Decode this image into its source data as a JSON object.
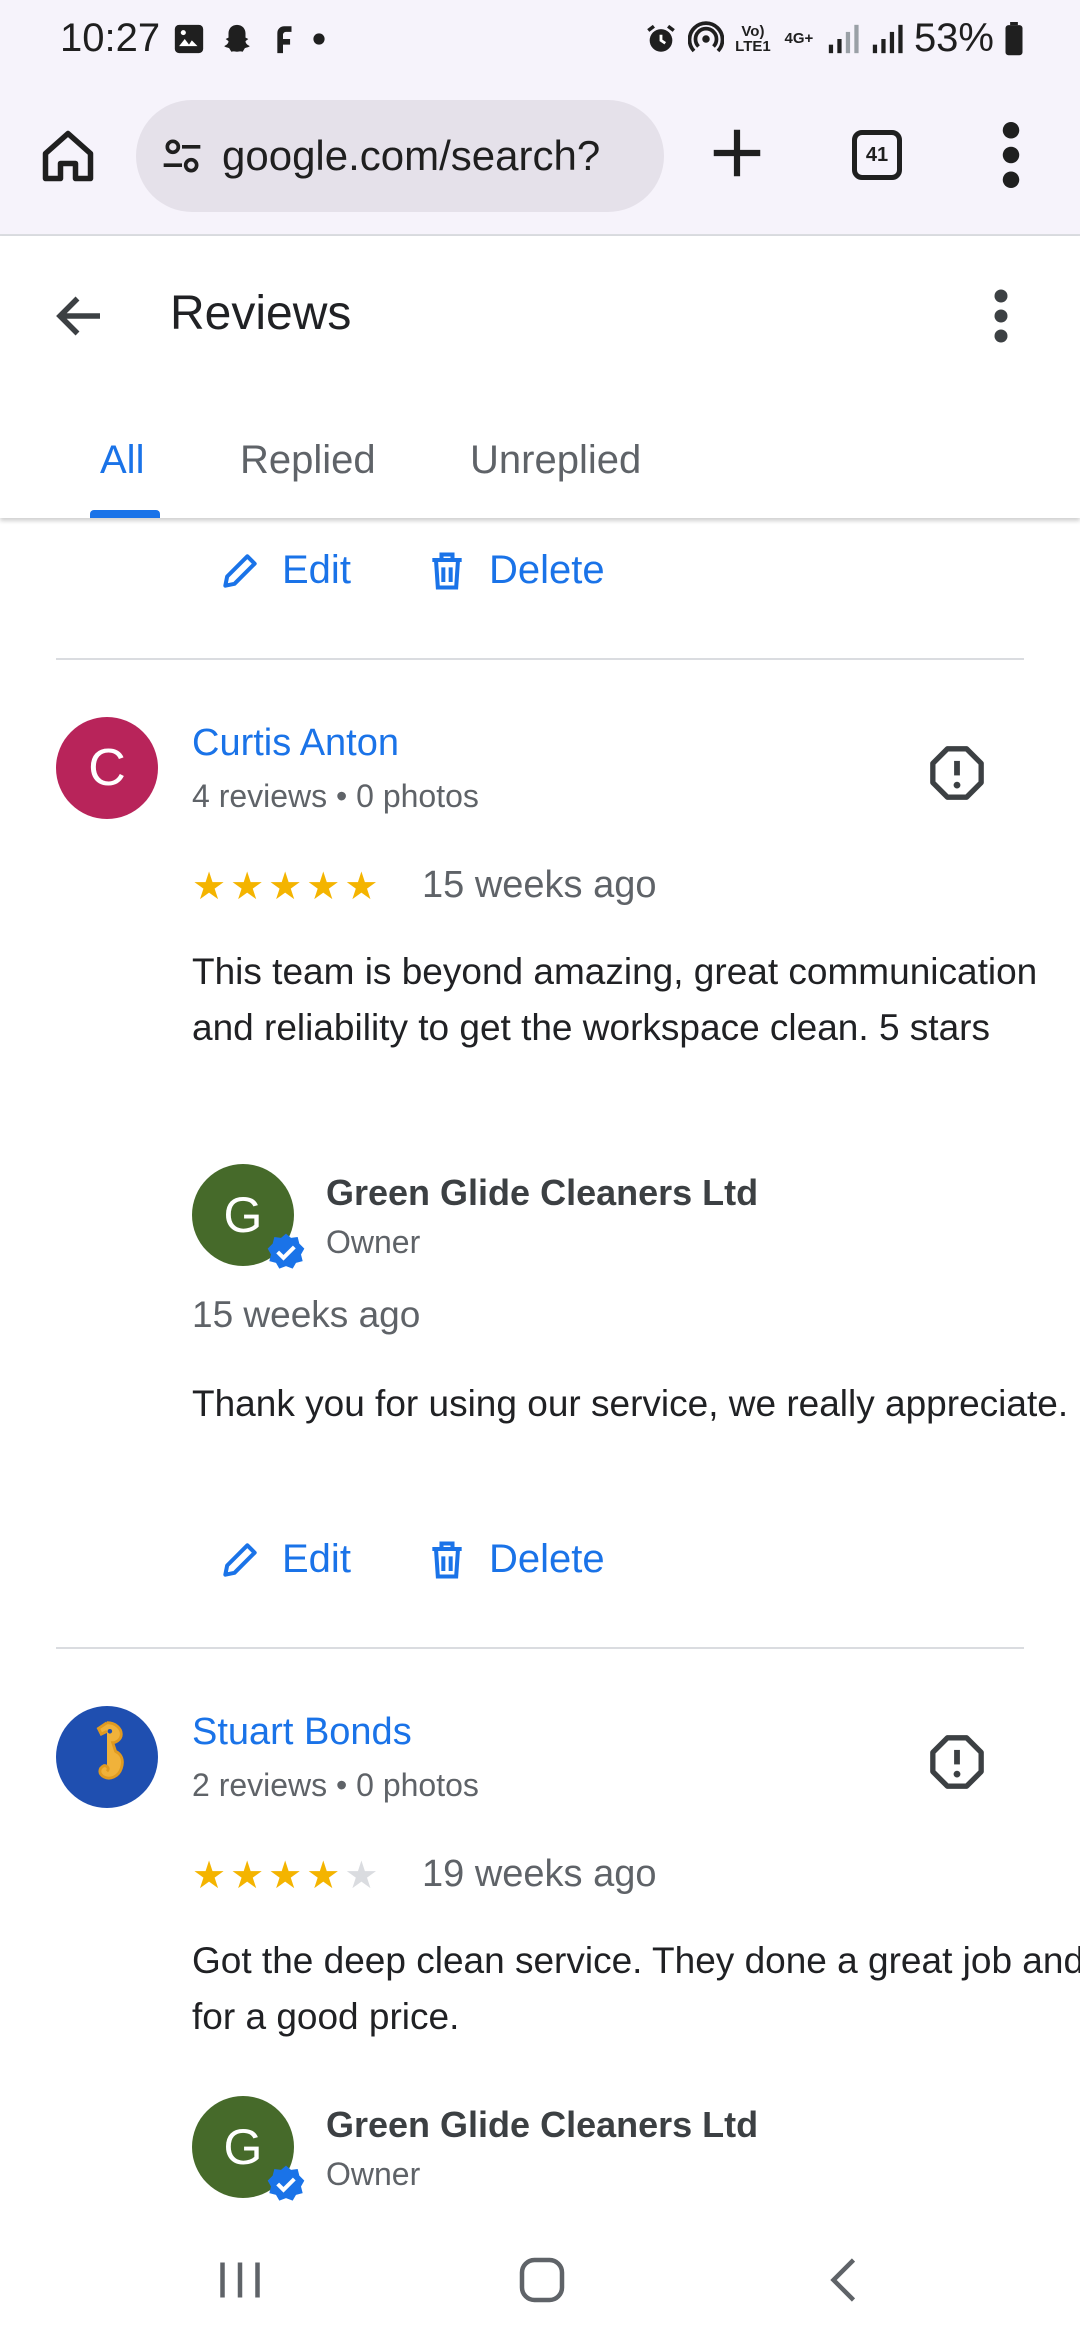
{
  "status_bar": {
    "time": "10:27",
    "battery": "53%",
    "network": "4G+",
    "lte": "Vo) LTE1"
  },
  "browser": {
    "url": "google.com/search?",
    "tab_count": "41"
  },
  "header": {
    "title": "Reviews"
  },
  "tabs": [
    {
      "label": "All",
      "active": true
    },
    {
      "label": "Replied",
      "active": false
    },
    {
      "label": "Unreplied",
      "active": false
    }
  ],
  "actions": {
    "edit_label": "Edit",
    "delete_label": "Delete"
  },
  "reviews": [
    {
      "reviewer": "Curtis Anton",
      "initial": "C",
      "avatar_color": "#b8245a",
      "meta": "4 reviews • 0 photos",
      "rating": 5,
      "time": "15 weeks ago",
      "text": "This team is beyond amazing, great communication and reliability to get the workspace clean. 5 stars",
      "reply": {
        "owner": "Green Glide Cleaners Ltd",
        "initial": "G",
        "role": "Owner",
        "time": "15 weeks ago",
        "text": "Thank you for using our service, we really appreciate."
      }
    },
    {
      "reviewer": "Stuart Bonds",
      "avatar_icon": "seahorse-icon",
      "avatar_color": "#1f4fb0",
      "meta": "2 reviews • 0 photos",
      "rating": 4,
      "time": "19 weeks ago",
      "text": "Got the deep clean service. They done a great job and for a good price.",
      "reply": {
        "owner": "Green Glide Cleaners Ltd",
        "initial": "G",
        "role": "Owner"
      }
    }
  ],
  "colors": {
    "accent": "#1a73e8",
    "star": "#f4b400",
    "owner_avatar": "#466a2a"
  }
}
